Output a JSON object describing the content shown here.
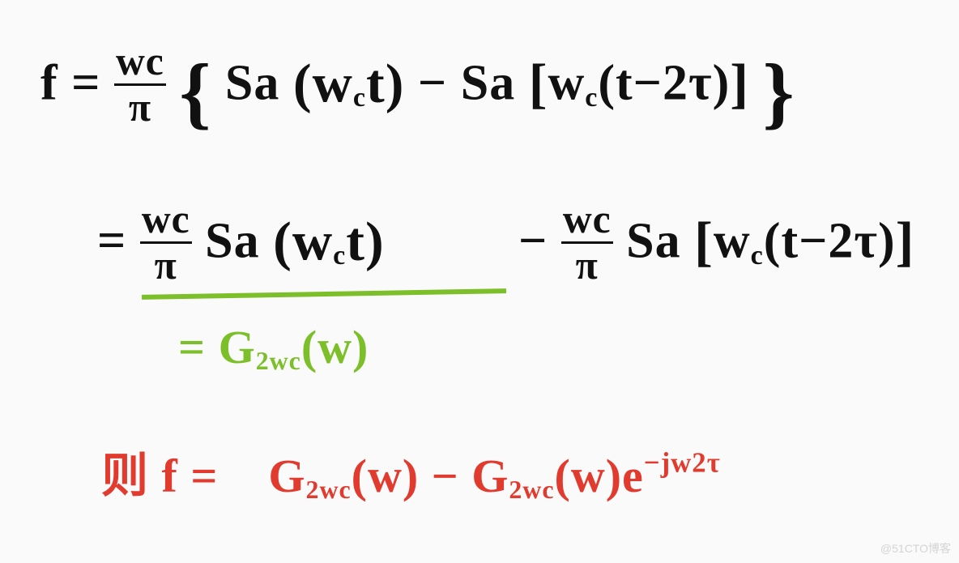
{
  "equations": {
    "line1": {
      "lhs": "f =",
      "frac_num": "wc",
      "frac_den": "π",
      "open": "{",
      "term1_fn": "Sa",
      "term1_arg": "(w",
      "term1_argsub": "c",
      "term1_argend": "t)",
      "minus": " − ",
      "term2_fn": "Sa",
      "term2_open": "[",
      "term2_w": "w",
      "term2_wsub": "c",
      "term2_rest": "(t−2τ)",
      "term2_close": "]",
      "close": "}"
    },
    "line2a": {
      "eq": "= ",
      "frac_num": "wc",
      "frac_den": "π",
      "fn": " Sa",
      "arg": "(w",
      "argsub": "c",
      "argend": "t)"
    },
    "line2b": {
      "minus": " − ",
      "frac_num": "wc",
      "frac_den": "π",
      "fn": " Sa",
      "open": "[",
      "w": "w",
      "wsub": "c",
      "rest": "(t−2τ)",
      "close": "]"
    },
    "line3": {
      "eq": "= ",
      "g": "G",
      "gsub": "2wc",
      "arg": "(w)"
    },
    "line4": {
      "prefix": "则 ",
      "lhs": "f = ",
      "g1": "G",
      "g1sub": "2wc",
      "g1arg": "(w)",
      "minus": " − ",
      "g2": "G",
      "g2sub": "2wc",
      "g2arg": "(w)e",
      "exp": "−jw2τ"
    }
  },
  "watermark": "@51CTO博客"
}
